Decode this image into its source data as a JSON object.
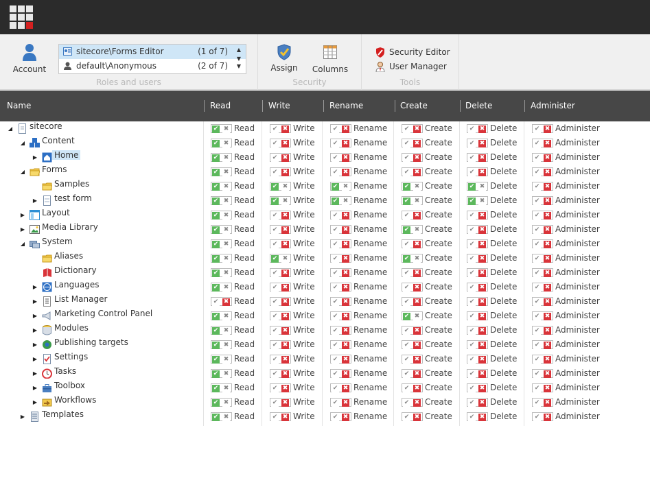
{
  "colors": {
    "allow": "#5cb85c",
    "deny": "#d9343a",
    "header": "#474747",
    "topbar": "#2b2b2b",
    "selection": "#cfe6f7"
  },
  "ribbon": {
    "account_label": "Account",
    "roles": [
      {
        "name": "sitecore\\Forms Editor",
        "count": "(1 of 7)",
        "icon": "role-icon"
      },
      {
        "name": "default\\Anonymous",
        "count": "(2 of 7)",
        "icon": "user-icon"
      }
    ],
    "roles_group_label": "Roles and users",
    "assign_label": "Assign",
    "columns_label": "Columns",
    "security_group_label": "Security",
    "security_editor_label": "Security Editor",
    "user_manager_label": "User Manager",
    "tools_group_label": "Tools"
  },
  "columns": [
    "Name",
    "Read",
    "Write",
    "Rename",
    "Create",
    "Delete",
    "Administer"
  ],
  "rows": [
    {
      "name": "sitecore",
      "depth": 0,
      "arrow": "expanded",
      "icon": "page-icon",
      "perms": [
        "A",
        "D",
        "D",
        "D",
        "D",
        "D"
      ]
    },
    {
      "name": "Content",
      "depth": 1,
      "arrow": "expanded",
      "icon": "content-icon",
      "perms": [
        "A",
        "D",
        "D",
        "D",
        "D",
        "D"
      ]
    },
    {
      "name": "Home",
      "depth": 2,
      "arrow": "collapsed",
      "icon": "home-icon",
      "selected": true,
      "perms": [
        "A",
        "D",
        "D",
        "D",
        "D",
        "D"
      ]
    },
    {
      "name": "Forms",
      "depth": 1,
      "arrow": "expanded",
      "icon": "folder-icon",
      "perms": [
        "A",
        "D",
        "D",
        "D",
        "D",
        "D"
      ]
    },
    {
      "name": "Samples",
      "depth": 2,
      "arrow": "none",
      "icon": "folder-icon",
      "perms": [
        "A",
        "A",
        "A",
        "A",
        "A",
        "D"
      ]
    },
    {
      "name": "test form",
      "depth": 2,
      "arrow": "collapsed",
      "icon": "form-icon",
      "perms": [
        "A",
        "A",
        "A",
        "A",
        "A",
        "D"
      ]
    },
    {
      "name": "Layout",
      "depth": 1,
      "arrow": "collapsed",
      "icon": "layout-icon",
      "perms": [
        "A",
        "D",
        "D",
        "D",
        "D",
        "D"
      ]
    },
    {
      "name": "Media Library",
      "depth": 1,
      "arrow": "collapsed",
      "icon": "image-icon",
      "perms": [
        "A",
        "D",
        "D",
        "A",
        "D",
        "D"
      ]
    },
    {
      "name": "System",
      "depth": 1,
      "arrow": "expanded",
      "icon": "system-icon",
      "perms": [
        "A",
        "D",
        "D",
        "D",
        "D",
        "D"
      ]
    },
    {
      "name": "Aliases",
      "depth": 2,
      "arrow": "none",
      "icon": "folder-icon",
      "perms": [
        "A",
        "A",
        "D",
        "A",
        "D",
        "D"
      ]
    },
    {
      "name": "Dictionary",
      "depth": 2,
      "arrow": "none",
      "icon": "book-icon",
      "perms": [
        "A",
        "D",
        "D",
        "D",
        "D",
        "D"
      ]
    },
    {
      "name": "Languages",
      "depth": 2,
      "arrow": "collapsed",
      "icon": "globe-icon",
      "perms": [
        "A",
        "D",
        "D",
        "D",
        "D",
        "D"
      ]
    },
    {
      "name": "List Manager",
      "depth": 2,
      "arrow": "collapsed",
      "icon": "list-icon",
      "perms": [
        "D",
        "D",
        "D",
        "D",
        "D",
        "D"
      ]
    },
    {
      "name": "Marketing Control Panel",
      "depth": 2,
      "arrow": "collapsed",
      "icon": "megaphone-icon",
      "perms": [
        "A",
        "D",
        "D",
        "A",
        "D",
        "D"
      ]
    },
    {
      "name": "Modules",
      "depth": 2,
      "arrow": "collapsed",
      "icon": "database-icon",
      "perms": [
        "A",
        "D",
        "D",
        "D",
        "D",
        "D"
      ]
    },
    {
      "name": "Publishing targets",
      "depth": 2,
      "arrow": "collapsed",
      "icon": "publish-icon",
      "perms": [
        "A",
        "D",
        "D",
        "D",
        "D",
        "D"
      ]
    },
    {
      "name": "Settings",
      "depth": 2,
      "arrow": "collapsed",
      "icon": "settings-icon",
      "perms": [
        "A",
        "D",
        "D",
        "D",
        "D",
        "D"
      ]
    },
    {
      "name": "Tasks",
      "depth": 2,
      "arrow": "collapsed",
      "icon": "clock-icon",
      "perms": [
        "A",
        "D",
        "D",
        "D",
        "D",
        "D"
      ]
    },
    {
      "name": "Toolbox",
      "depth": 2,
      "arrow": "collapsed",
      "icon": "toolbox-icon",
      "perms": [
        "A",
        "D",
        "D",
        "D",
        "D",
        "D"
      ]
    },
    {
      "name": "Workflows",
      "depth": 2,
      "arrow": "collapsed",
      "icon": "workflow-icon",
      "perms": [
        "A",
        "D",
        "D",
        "D",
        "D",
        "D"
      ]
    },
    {
      "name": "Templates",
      "depth": 1,
      "arrow": "collapsed",
      "icon": "template-icon",
      "perms": [
        "A",
        "D",
        "D",
        "D",
        "D",
        "D"
      ]
    }
  ]
}
